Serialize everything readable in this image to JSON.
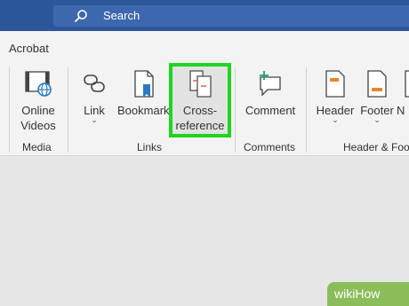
{
  "search": {
    "label": "Search"
  },
  "tab": {
    "label": "Acrobat"
  },
  "buttons": {
    "online_videos": "Online\nVideos",
    "link": "Link",
    "bookmark": "Bookmark",
    "cross_reference": "Cross-\nreference",
    "comment": "Comment",
    "header": "Header",
    "footer": "Footer",
    "partial": "N"
  },
  "groups": {
    "media": "Media",
    "links": "Links",
    "comments": "Comments",
    "header_footer": "Header & Foo"
  },
  "highlight_color": "#21d41f",
  "watermark": "wikiHow"
}
